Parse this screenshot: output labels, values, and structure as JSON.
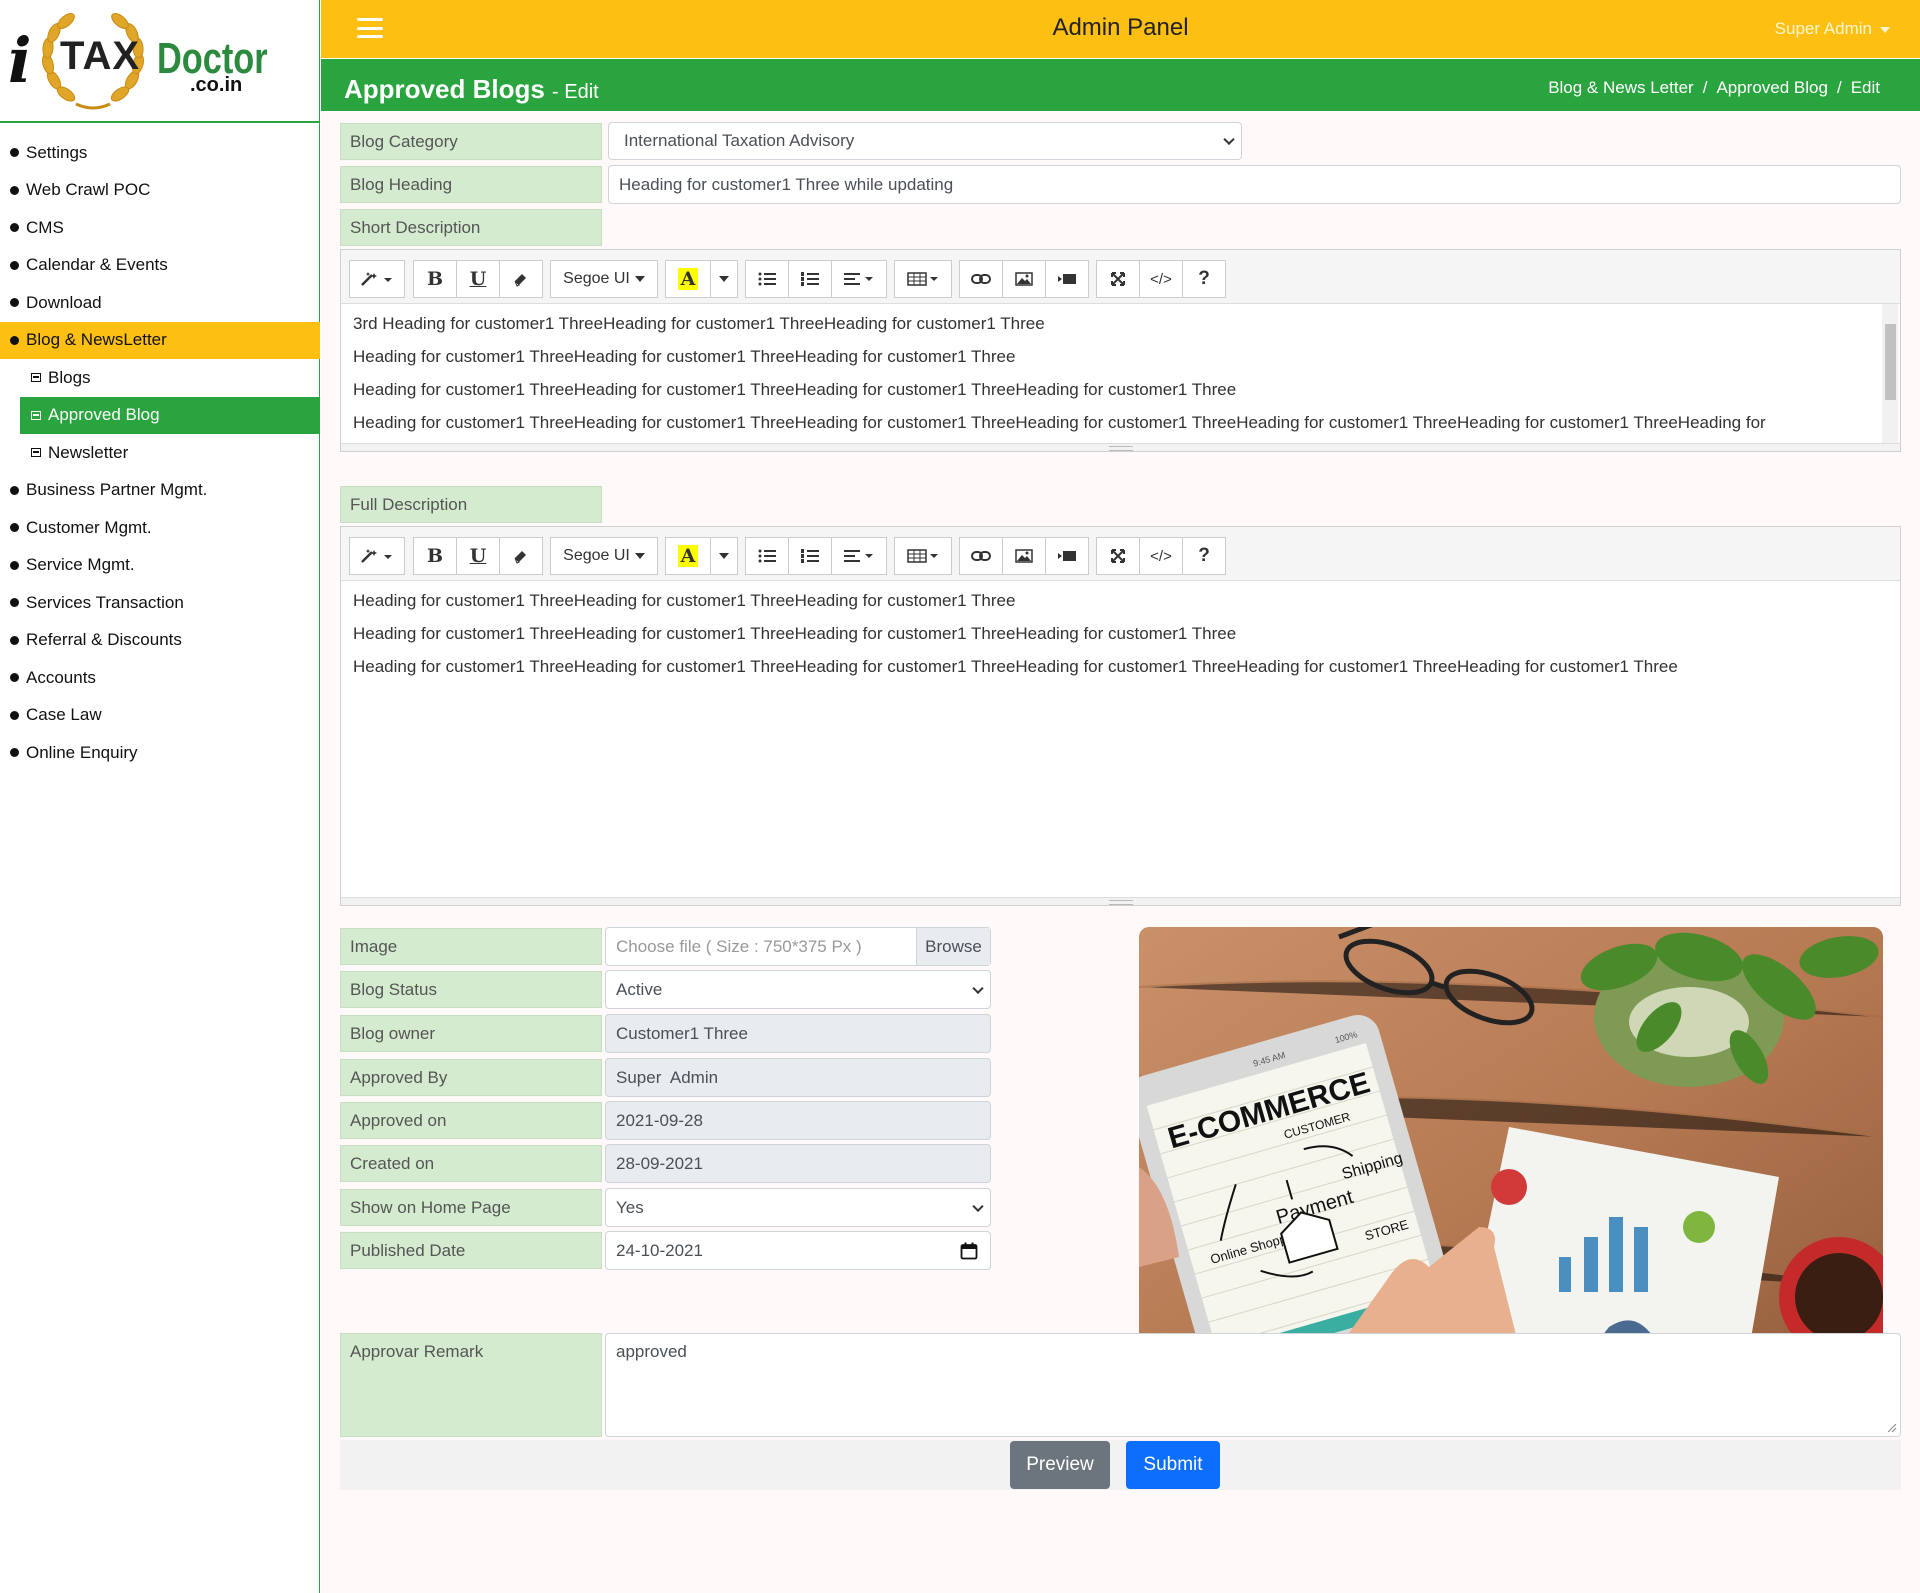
{
  "logo": {
    "i": "i",
    "tax": "TAX",
    "doctor": "Doctor",
    "domain": ".co.in"
  },
  "nav": {
    "items": [
      {
        "label": "Settings"
      },
      {
        "label": "Web Crawl POC"
      },
      {
        "label": "CMS"
      },
      {
        "label": "Calendar & Events"
      },
      {
        "label": "Download"
      },
      {
        "label": "Blog & NewsLetter"
      },
      {
        "label": "Business Partner Mgmt."
      },
      {
        "label": "Customer Mgmt."
      },
      {
        "label": "Service Mgmt."
      },
      {
        "label": "Services Transaction"
      },
      {
        "label": "Referral & Discounts"
      },
      {
        "label": "Accounts"
      },
      {
        "label": "Case Law"
      },
      {
        "label": "Online Enquiry"
      }
    ],
    "subitems": [
      {
        "label": "Blogs"
      },
      {
        "label": "Approved Blog"
      },
      {
        "label": "Newsletter"
      }
    ],
    "active_colors": {
      "parent": "#fdbf12",
      "child": "#2aa43e"
    }
  },
  "topbar": {
    "title": "Admin Panel",
    "user": "Super Admin"
  },
  "pagebar": {
    "title": "Approved Blogs",
    "subtitle": "- Edit",
    "breadcrumb": [
      "Blog & News Letter",
      "Approved Blog",
      "Edit"
    ]
  },
  "form": {
    "blog_category": {
      "label": "Blog Category",
      "value": "International Taxation Advisory"
    },
    "blog_heading": {
      "label": "Blog Heading",
      "value": "Heading for customer1 Three while updating"
    },
    "short_description": {
      "label": "Short Description",
      "lines": [
        "3rd Heading for customer1 ThreeHeading for customer1 ThreeHeading for customer1 Three",
        "Heading for customer1 ThreeHeading for customer1 ThreeHeading for customer1 Three",
        "Heading for customer1 ThreeHeading for customer1 ThreeHeading for customer1 ThreeHeading for customer1 Three",
        "Heading for customer1 ThreeHeading for customer1 ThreeHeading for customer1 ThreeHeading for customer1 ThreeHeading for customer1 ThreeHeading for customer1 ThreeHeading for"
      ]
    },
    "full_description": {
      "label": "Full Description",
      "lines": [
        "Heading for customer1 ThreeHeading for customer1 ThreeHeading for customer1 Three",
        "Heading for customer1 ThreeHeading for customer1 ThreeHeading for customer1 ThreeHeading for customer1 Three",
        "Heading for customer1 ThreeHeading for customer1 ThreeHeading for customer1 ThreeHeading for customer1 ThreeHeading for customer1 ThreeHeading for customer1 Three"
      ]
    },
    "toolbar": {
      "bold": "B",
      "underline": "U",
      "font": "Segoe UI",
      "highlight": "A",
      "code": "</>",
      "help": "?"
    },
    "image": {
      "label": "Image",
      "placeholder": "Choose file ( Size : 750*375 Px )",
      "browse": "Browse"
    },
    "blog_status": {
      "label": "Blog Status",
      "value": "Active"
    },
    "blog_owner": {
      "label": "Blog owner",
      "value": "Customer1 Three"
    },
    "approved_by": {
      "label": "Approved By",
      "value": "Super  Admin"
    },
    "approved_on": {
      "label": "Approved on",
      "value": "2021-09-28"
    },
    "created_on": {
      "label": "Created on",
      "value": "28-09-2021"
    },
    "show_on_home": {
      "label": "Show on Home Page",
      "value": "Yes"
    },
    "published_date": {
      "label": "Published Date",
      "value": "24-10-2021"
    },
    "remark": {
      "label": "Approvar Remark",
      "value": "approved"
    }
  },
  "image_preview": {
    "title": "E-COMMERCE",
    "words": [
      "CUSTOMER",
      "Payment",
      "Shipping",
      "Online Shopping",
      "STORE"
    ],
    "time": "9:45 AM",
    "battery": "100%"
  },
  "buttons": {
    "preview": "Preview",
    "submit": "Submit"
  },
  "colors": {
    "yellow": "#fdbf12",
    "green": "#2aa43e",
    "label_bg": "#d5ebd0",
    "preview_btn": "#6c757d",
    "submit_btn": "#0d6efd"
  }
}
